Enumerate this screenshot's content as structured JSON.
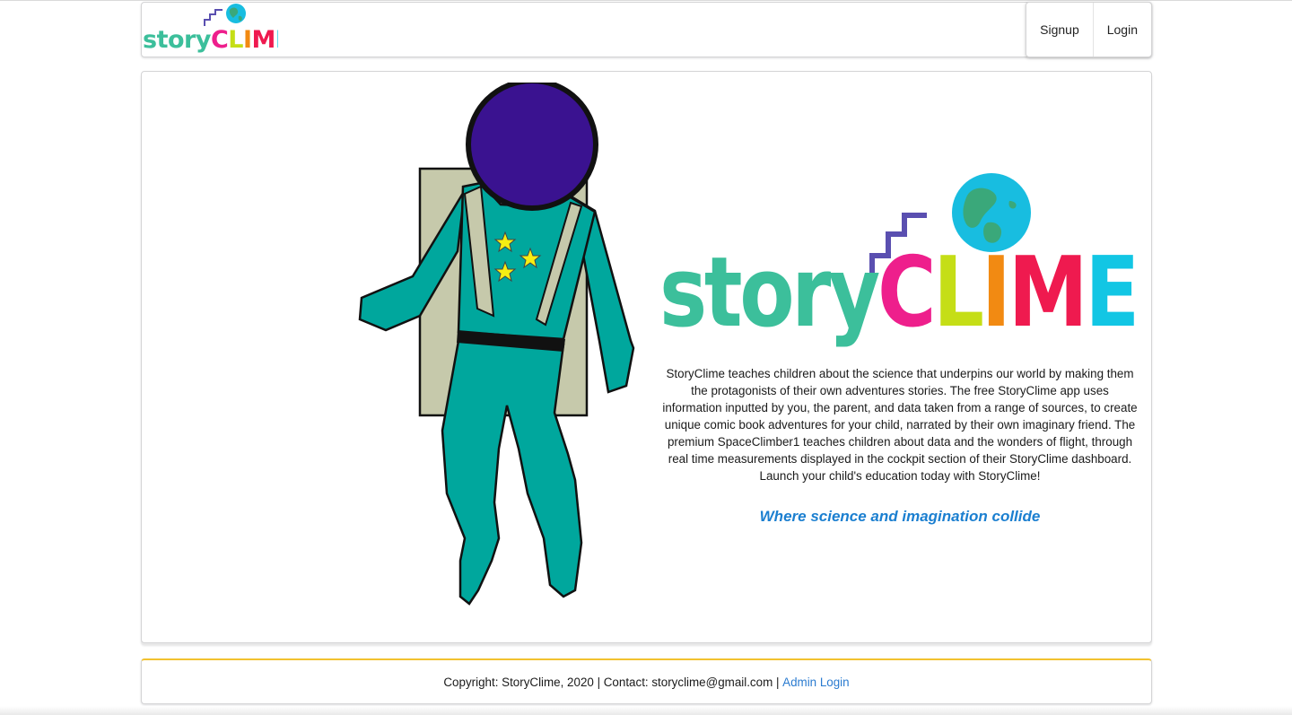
{
  "header": {
    "logo": {
      "word1": "story",
      "word2": [
        "C",
        "L",
        "I",
        "M",
        "E"
      ]
    },
    "nav": {
      "signup_label": "Signup",
      "login_label": "Login"
    }
  },
  "main": {
    "big_logo": {
      "word1": "story",
      "word2": [
        "C",
        "L",
        "I",
        "M",
        "E"
      ]
    },
    "description": "StoryClime teaches children about the science that underpins our world by making them the protagonists of their own adventures stories. The free StoryClime app uses information inputted by you, the parent, and data taken from a range of sources, to create unique comic book adventures for your child, narrated by their own imaginary friend. The premium SpaceClimber1 teaches children about data and the wonders of flight, through real time measurements displayed in the cockpit section of their StoryClime dashboard. Launch your child's education today with StoryClime!",
    "tagline": "Where science and imagination collide"
  },
  "footer": {
    "copyright_text": "Copyright: StoryClime, 2020 | Contact: storyclime@gmail.com | ",
    "admin_link": "Admin Login"
  },
  "colors": {
    "story_green": "#3cbf9b",
    "c_pink": "#ee1f8c",
    "l_lime": "#c5de16",
    "i_orange": "#f28a12",
    "m_red": "#ef1a4f",
    "e_cyan": "#12c6e4",
    "stairs": "#5a4fb0",
    "globe_ocean": "#18bde0",
    "globe_land": "#3aa87a",
    "helmet": "#3a1290",
    "suit": "#00a79d",
    "backpack": "#c6c9ab",
    "star": "#f6ee12",
    "tagline": "#1b7fd0",
    "footer_border": "#f2c230"
  }
}
